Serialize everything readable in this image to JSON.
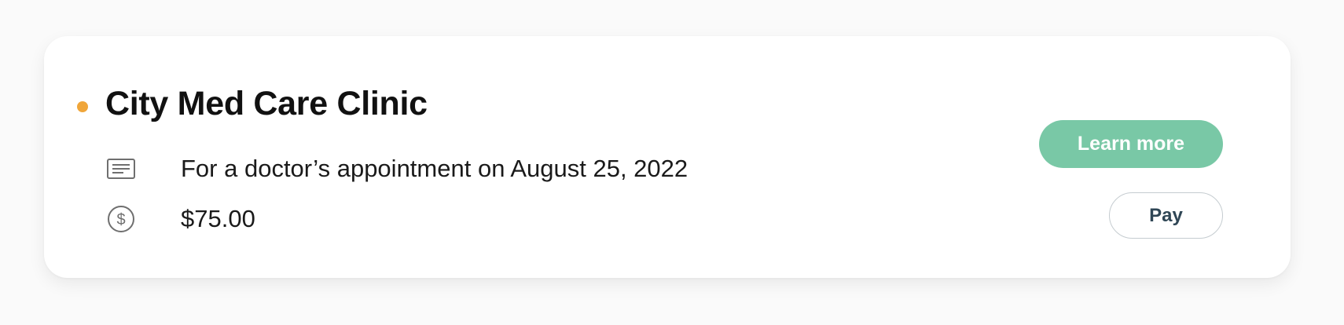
{
  "bill": {
    "provider": "City Med Care Clinic",
    "status_color": "#f0a63a",
    "description": "For a doctor’s appointment on August 25, 2022",
    "description_icon": "document-lines-icon",
    "amount": "$75.00",
    "amount_icon": "dollar-circle-icon"
  },
  "actions": {
    "learn_more_label": "Learn more",
    "pay_label": "Pay"
  },
  "colors": {
    "accent_green": "#79c8a6",
    "pay_text": "#2f4655",
    "icon_gray": "#6f6f6f"
  }
}
